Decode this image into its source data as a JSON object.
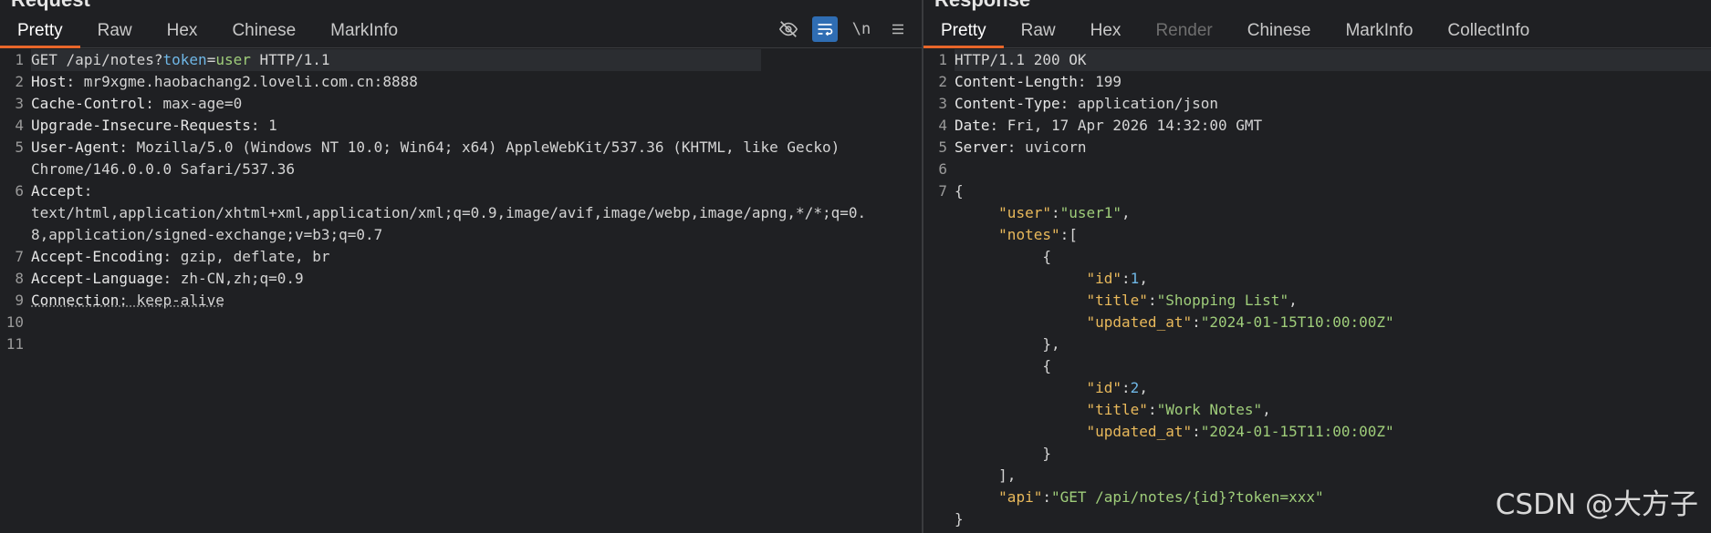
{
  "request": {
    "title": "Request",
    "tabs": [
      "Pretty",
      "Raw",
      "Hex",
      "Chinese",
      "MarkInfo"
    ],
    "toolbar": {
      "hide_icon": "eye-slash-icon",
      "wrap_icon": "wrap-lines-icon",
      "newline_label": "\\n",
      "menu_icon": "hamburger-menu-icon"
    },
    "lines": {
      "l1_method": "GET",
      "l1_path": "/api/notes?",
      "l1_param": "token",
      "l1_eq": "=",
      "l1_value": "user",
      "l1_proto": " HTTP/1.1",
      "l2_name": "Host",
      "l2_value": ": mr9xgme.haobachang2.loveli.com.cn:8888",
      "l3_name": "Cache-Control",
      "l3_value": ": max-age=0",
      "l4_name": "Upgrade-Insecure-Requests",
      "l4_value": ": 1",
      "l5_name": "User-Agent",
      "l5_value": ": Mozilla/5.0 (Windows NT 10.0; Win64; x64) AppleWebKit/537.36 (KHTML, like Gecko)",
      "l5_cont": "Chrome/146.0.0.0 Safari/537.36",
      "l6_name": "Accept",
      "l6_value": ":",
      "l6_cont1": "text/html,application/xhtml+xml,application/xml;q=0.9,image/avif,image/webp,image/apng,*/*;q=0.",
      "l6_cont2": "8,application/signed-exchange;v=b3;q=0.7",
      "l7_name": "Accept-Encoding",
      "l7_value": ": gzip, deflate, br",
      "l8_name": "Accept-Language",
      "l8_value": ": zh-CN,zh;q=0.9",
      "l9_name": "Connection",
      "l9_value": ": keep-alive"
    },
    "line_numbers": [
      "1",
      "2",
      "3",
      "4",
      "5",
      "6",
      "7",
      "8",
      "9",
      "10",
      "11"
    ]
  },
  "response": {
    "title": "Response",
    "tabs": [
      "Pretty",
      "Raw",
      "Hex",
      "Render",
      "Chinese",
      "MarkInfo",
      "CollectInfo"
    ],
    "lines": {
      "l1": "HTTP/1.1 200 OK",
      "l2_name": "Content-Length",
      "l2_value": ": 199",
      "l3_name": "Content-Type",
      "l3_value": ": application/json",
      "l4_name": "Date",
      "l4_value": ": Fri, 17 Apr 2026 14:32:00 GMT",
      "l5_name": "Server",
      "l5_value": ": uvicorn",
      "brace_open": "{",
      "user_key": "\"user\"",
      "user_val": "\"user1\"",
      "notes_key": "\"notes\"",
      "id_key": "\"id\"",
      "id1": "1",
      "title_key": "\"title\"",
      "title1": "\"Shopping List\"",
      "updated_key": "\"updated_at\"",
      "updated1": "\"2024-01-15T10:00:00Z\"",
      "id2": "2",
      "title2": "\"Work Notes\"",
      "updated2": "\"2024-01-15T11:00:00Z\"",
      "api_key": "\"api\"",
      "api_val": "\"GET /api/notes/{id}?token=xxx\"",
      "brace_close": "}"
    },
    "line_numbers": [
      "1",
      "2",
      "3",
      "4",
      "5",
      "6",
      "7"
    ]
  },
  "watermark": "CSDN @大方子",
  "colors": {
    "accent_tab": "#e8662a",
    "json_key": "#e9b95b",
    "json_string": "#9fcd7a",
    "json_number": "#6fb7e6"
  }
}
